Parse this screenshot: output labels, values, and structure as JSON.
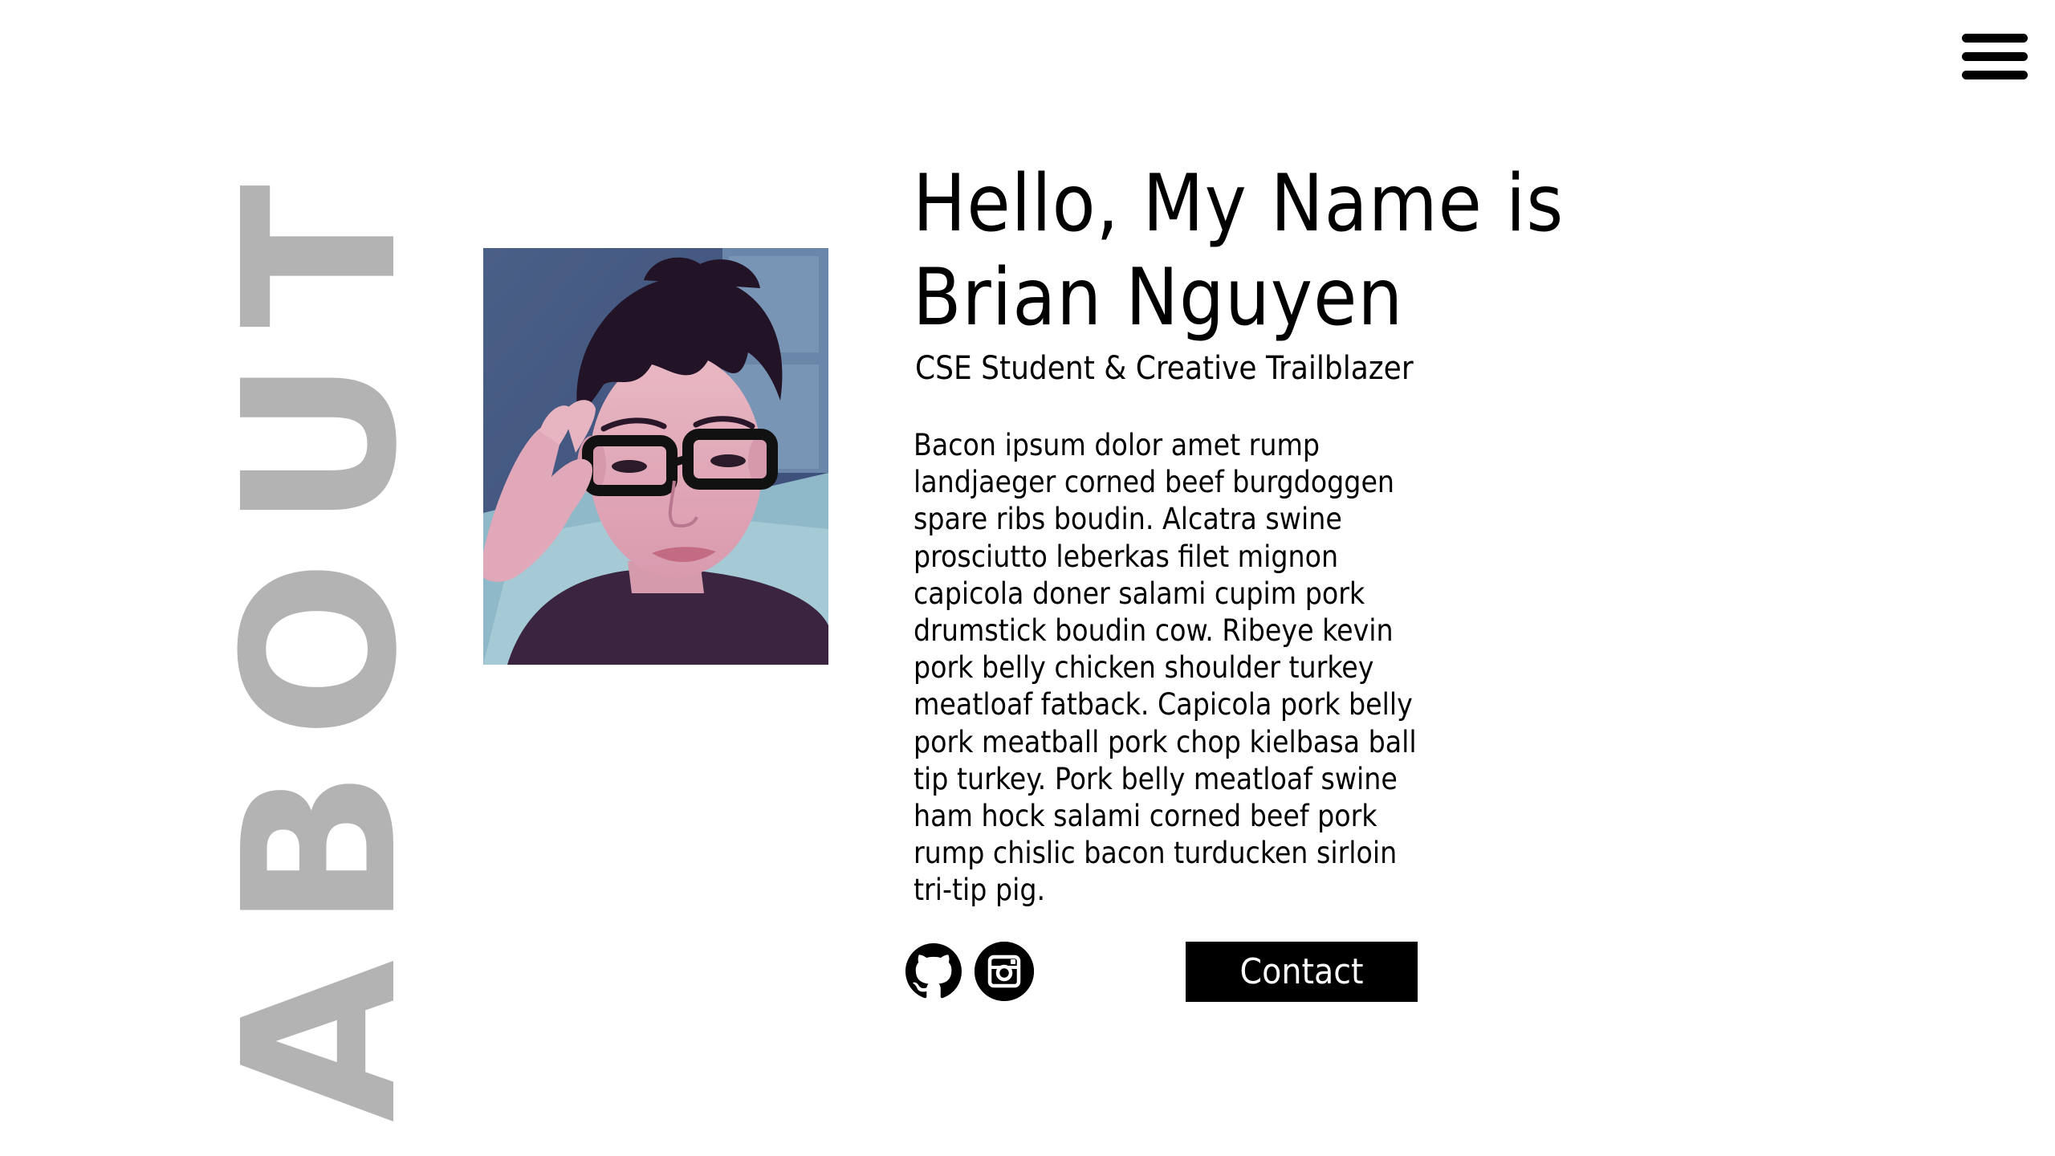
{
  "nav": {
    "menu_icon": "hamburger-menu-icon"
  },
  "about": {
    "side_title": "ABOUT",
    "heading_line1": "Hello, My Name is",
    "heading_line2": "Brian Nguyen",
    "subtitle": "CSE Student & Creative Trailblazer",
    "bio": "Bacon ipsum dolor amet rump landjaeger corned beef burgdoggen spare ribs boudin. Alcatra swine prosciutto leberkas filet mignon capicola doner salami cupim pork drumstick boudin cow. Ribeye kevin pork belly chicken shoulder turkey meatloaf fatback. Capicola pork belly pork meatball pork chop kielbasa ball tip turkey. Pork belly meatloaf swine ham hock salami corned beef pork rump chislic bacon turducken sirloin tri-tip pig.",
    "photo_icon": "profile-photo",
    "social": [
      {
        "name": "github",
        "icon": "github-icon"
      },
      {
        "name": "instagram",
        "icon": "instagram-icon"
      }
    ],
    "contact_label": "Contact"
  },
  "colors": {
    "background": "#ffffff",
    "text": "#000000",
    "side_title": "#b3b3b3",
    "button_bg": "#000000",
    "button_text": "#ffffff"
  }
}
